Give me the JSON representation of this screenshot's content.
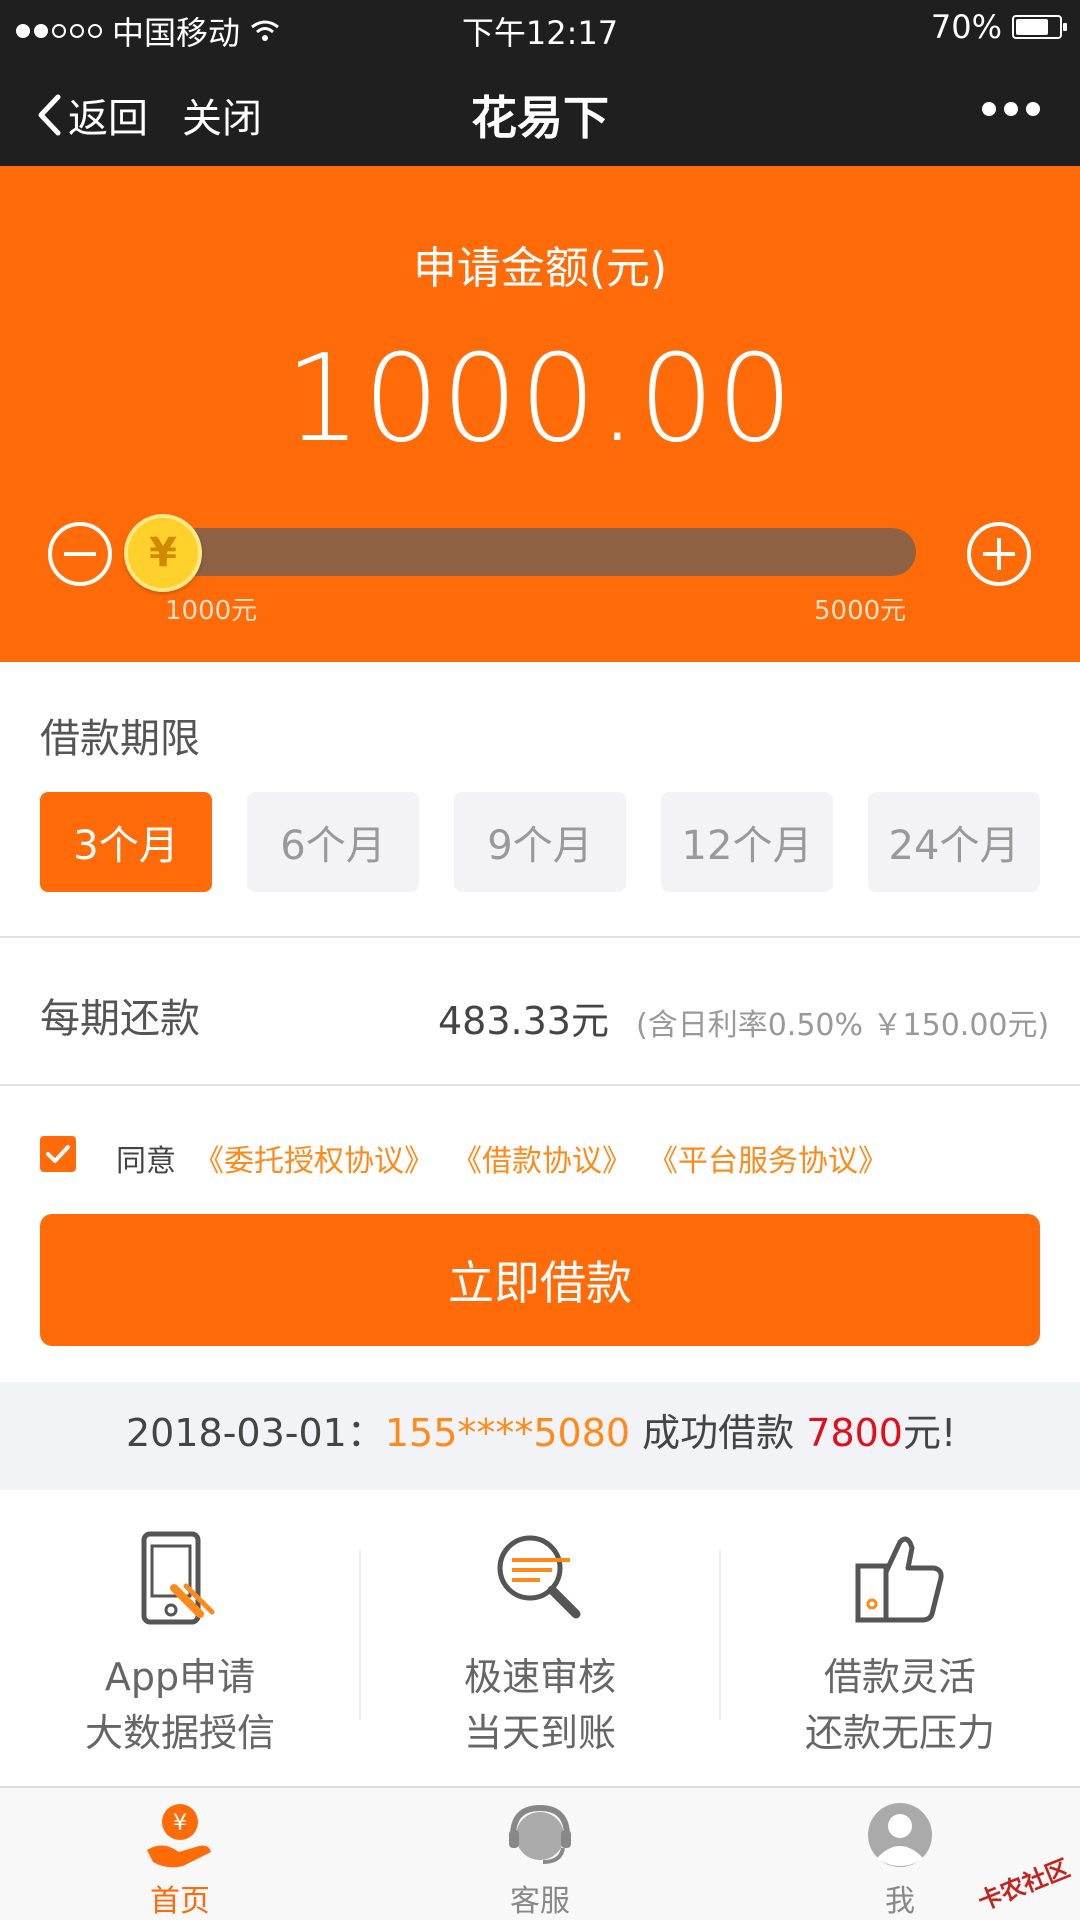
{
  "status_bar": {
    "carrier": "中国移动",
    "time": "下午12:17",
    "battery": "70%"
  },
  "nav": {
    "back_label": "返回",
    "close_label": "关闭",
    "title": "花易下"
  },
  "amount_panel": {
    "label": "申请金额(元)",
    "value": "1000.00",
    "slider": {
      "min_label": "1000元",
      "max_label": "5000元",
      "knob_symbol": "¥",
      "level": 0
    }
  },
  "loan_term": {
    "label": "借款期限",
    "options": [
      "3个月",
      "6个月",
      "9个月",
      "12个月",
      "24个月"
    ],
    "selected": "3个月"
  },
  "repayment": {
    "label": "每期还款",
    "value": "483.33元",
    "note": "(含日利率0.50% ￥150.00元)"
  },
  "agreement": {
    "checked": true,
    "prefix": "同意",
    "links": [
      "《委托授权协议》",
      "《借款协议》",
      "《平台服务协议》"
    ]
  },
  "borrow_button": {
    "label": "立即借款"
  },
  "ticker": {
    "date": "2018-03-01：",
    "phone": "155****5080",
    "middle": " 成功借款 ",
    "amount": "7800",
    "suffix": "元!"
  },
  "features": [
    {
      "line1": "App申请",
      "line2": "大数据授信",
      "icon": "phone-app-icon"
    },
    {
      "line1": "极速审核",
      "line2": "当天到账",
      "icon": "magnifier-icon"
    },
    {
      "line1": "借款灵活",
      "line2": "还款无压力",
      "icon": "thumbs-up-icon"
    }
  ],
  "tab_bar": {
    "items": [
      {
        "label": "首页",
        "icon": "home-yen-icon",
        "active": true
      },
      {
        "label": "客服",
        "icon": "customer-service-icon",
        "active": false
      },
      {
        "label": "我",
        "icon": "profile-icon",
        "active": false
      }
    ]
  },
  "watermark": "卡农社区",
  "colors": {
    "accent": "#ff6b08",
    "link": "#ff8a1a",
    "amount_red": "#e0101a",
    "nav_bg": "#1f1f1f"
  }
}
